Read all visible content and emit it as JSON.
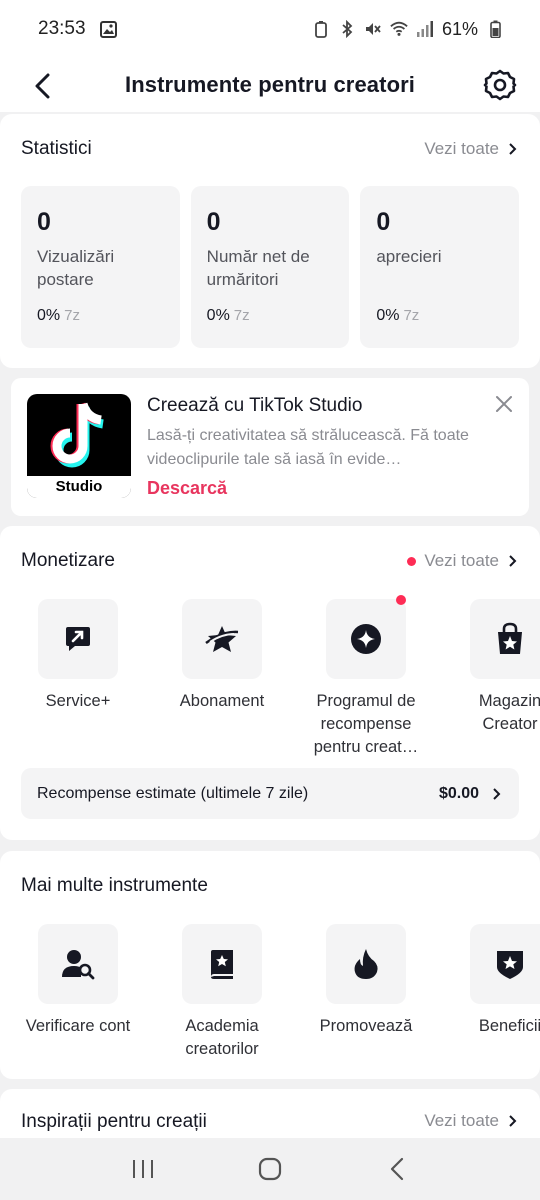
{
  "status": {
    "time": "23:53",
    "battery": "61%"
  },
  "header": {
    "title": "Instrumente pentru creatori"
  },
  "stats": {
    "title": "Statistici",
    "see_all": "Vezi toate",
    "cards": [
      {
        "value": "0",
        "label": "Vizualizări postare",
        "change": "0%",
        "period": "7z"
      },
      {
        "value": "0",
        "label": "Număr net de urmăritori",
        "change": "0%",
        "period": "7z"
      },
      {
        "value": "0",
        "label": "aprecieri",
        "change": "0%",
        "period": "7z"
      }
    ]
  },
  "promo": {
    "logo_text": "Studio",
    "title": "Creează cu TikTok Studio",
    "description": "Lasă-ți creativitatea să strălucească. Fă toate videoclipurile tale să iasă în evide…",
    "link": "Descarcă"
  },
  "monetization": {
    "title": "Monetizare",
    "see_all": "Vezi toate",
    "tools": [
      {
        "label": "Service+",
        "icon": "service-plus-icon"
      },
      {
        "label": "Abonament",
        "icon": "subscription-star-icon"
      },
      {
        "label": "Programul de recompense pentru creat…",
        "icon": "rewards-sparkle-icon"
      },
      {
        "label": "Magazin Creator",
        "icon": "shopping-bag-icon"
      }
    ],
    "rewards_label": "Recompense estimate (ultimele 7 zile)",
    "rewards_amount": "$0.00"
  },
  "more_tools": {
    "title": "Mai multe instrumente",
    "tools": [
      {
        "label": "Verificare cont",
        "icon": "user-search-icon"
      },
      {
        "label": "Academia creatorilor",
        "icon": "book-star-icon"
      },
      {
        "label": "Promovează",
        "icon": "flame-icon"
      },
      {
        "label": "Beneficii",
        "icon": "badge-star-icon"
      }
    ]
  },
  "inspiration": {
    "title": "Inspirații pentru creații",
    "see_all": "Vezi toate"
  }
}
